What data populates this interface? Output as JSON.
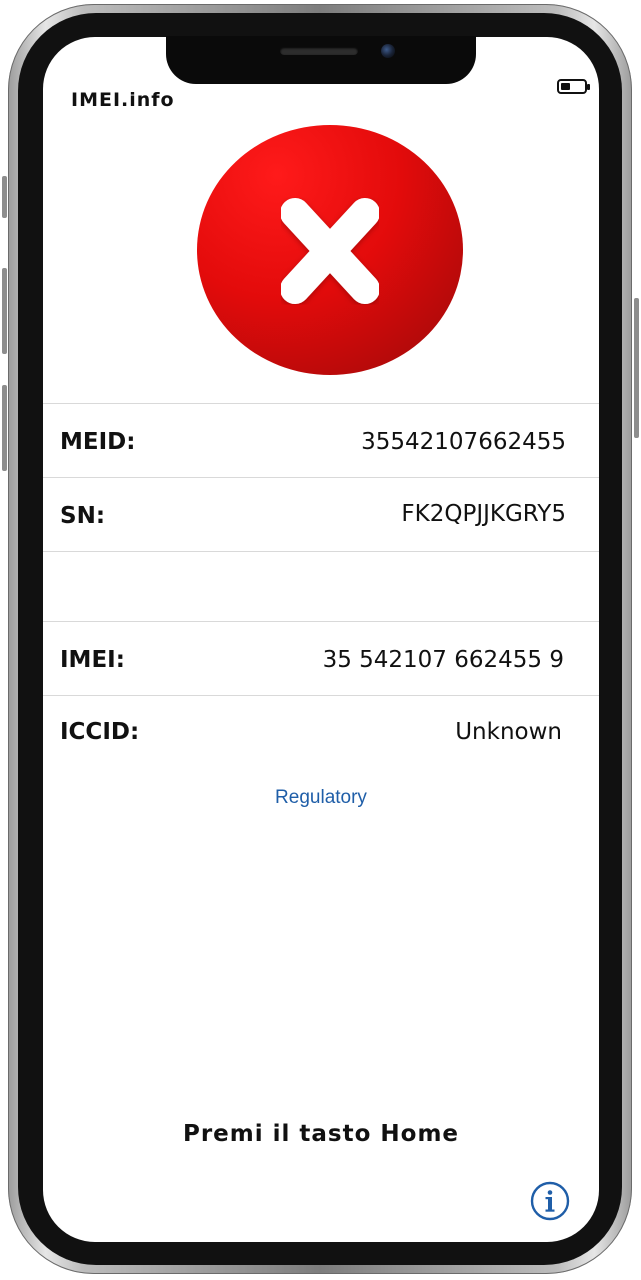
{
  "app": {
    "brand": "IMEI.info",
    "battery_level": 0.4
  },
  "status": {
    "icon": "x-mark-icon",
    "color": "#e30b0b"
  },
  "rows": [
    {
      "label": "MEID:",
      "value": "35542107662455"
    },
    {
      "label": "SN:",
      "value": "FK2QPJJKGRY5"
    },
    {
      "label": "",
      "value": ""
    },
    {
      "label": "IMEI:",
      "value": "35 542107 662455 9"
    },
    {
      "label": "ICCID:",
      "value": "Unknown"
    }
  ],
  "links": {
    "regulatory": "Regulatory"
  },
  "footer": {
    "hint": "Premi il tasto Home",
    "info_icon": "info-icon"
  },
  "colors": {
    "link": "#1f5ea8",
    "error": "#e30b0b"
  }
}
